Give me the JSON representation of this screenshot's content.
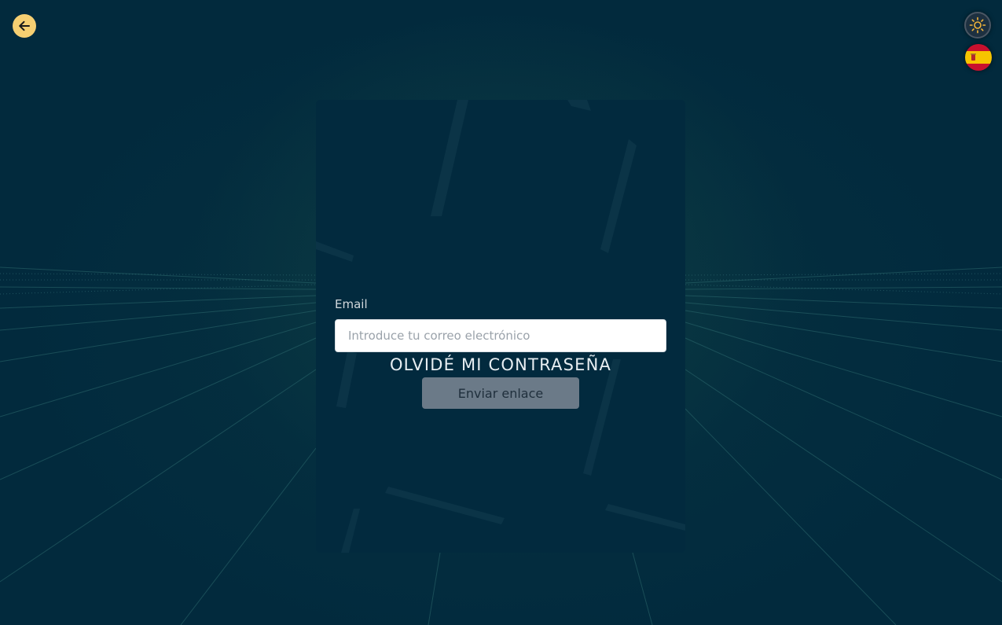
{
  "header": {
    "back_icon": "arrow-left-icon",
    "theme_icon": "sun-icon",
    "language_icon": "spain-flag-icon"
  },
  "form": {
    "title": "OLVIDÉ MI CONTRASEÑA",
    "email_label": "Email",
    "email_placeholder": "Introduce tu correo electrónico",
    "email_value": "",
    "submit_label": "Enviar enlace"
  },
  "colors": {
    "background": "#022a3d",
    "accent": "#f6cf72",
    "button_disabled": "#6b7a88"
  }
}
